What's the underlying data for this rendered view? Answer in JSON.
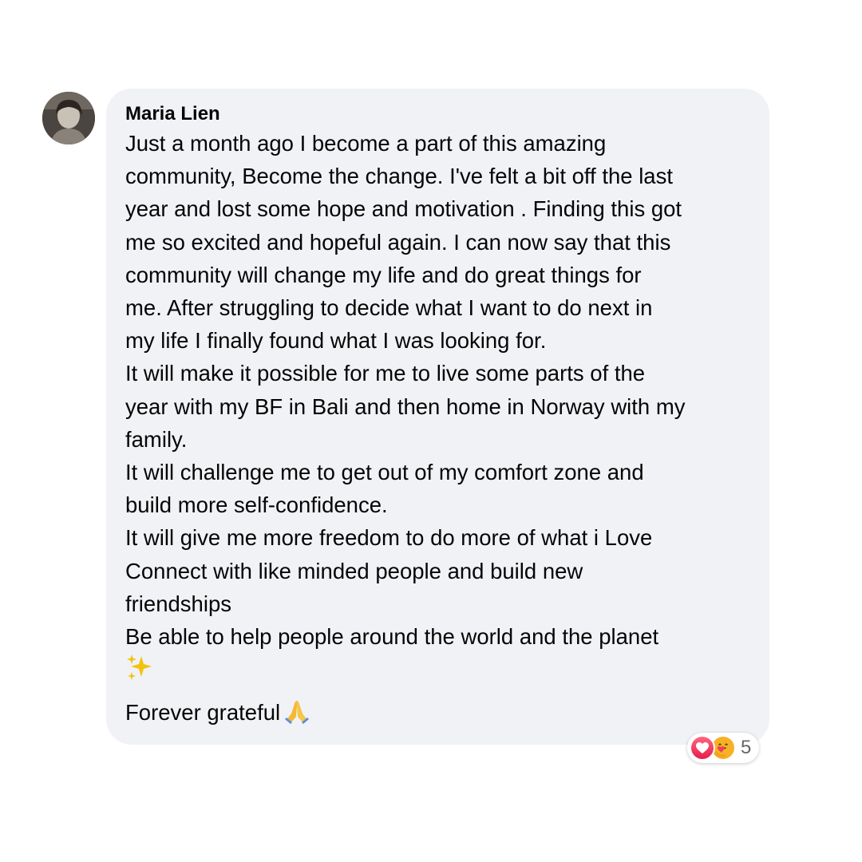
{
  "comment": {
    "author": "Maria Lien",
    "lines": [
      "Just a month ago I become a part of this amazing",
      "community, Become the change. I've felt a bit off the last",
      "year and lost some hope and motivation . Finding this got",
      "me so excited and hopeful again. I can now say that this",
      "community will change my life and do great things for",
      "me. After struggling to decide what I want to do next in",
      "my life I finally found what I was looking for.",
      "It will make it possible for me to live some parts of the",
      "year with my BF in Bali and then home in Norway with my",
      "family.",
      "It will challenge me to get out of my comfort zone and",
      "build more self-confidence.",
      "It will give me more freedom to do more of what i Love",
      "Connect with like minded people and build new",
      "friendships",
      "Be able to help people around the world and the planet"
    ],
    "sparkles_emoji": "sparkles-emoji",
    "closing": "Forever grateful",
    "closing_emoji": "folded-hands-emoji"
  },
  "reactions": {
    "types": [
      "love-reaction-icon",
      "care-reaction-icon"
    ],
    "count": "5",
    "love_color": "#f33e58",
    "care_color": "#f7b125"
  },
  "colors": {
    "bubble_bg": "#f0f2f5",
    "text": "#050505",
    "count_text": "#65676b"
  }
}
